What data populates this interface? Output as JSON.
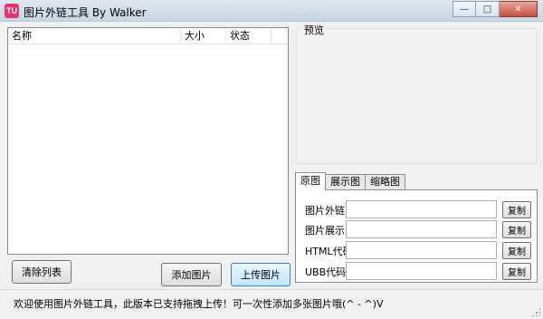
{
  "window": {
    "title": "图片外链工具 By Walker",
    "app_icon_text": "TU",
    "background_title_text": "...  ...  ...",
    "controls": {
      "minimize": "—",
      "maximize": "□",
      "close": "✕"
    }
  },
  "file_list": {
    "columns": [
      "名称",
      "大小",
      "状态",
      ""
    ],
    "rows": []
  },
  "buttons": {
    "clear": "清除列表",
    "add": "添加图片",
    "upload": "上传图片"
  },
  "preview": {
    "label": "预览"
  },
  "tabs": [
    "原图",
    "展示图",
    "缩略图"
  ],
  "link_rows": [
    {
      "label": "图片外链",
      "value": "",
      "button": "复制"
    },
    {
      "label": "图片展示",
      "value": "",
      "button": "复制"
    },
    {
      "label": "HTML代码",
      "value": "",
      "button": "复制"
    },
    {
      "label": "UBB代码",
      "value": "",
      "button": "复制"
    }
  ],
  "status": {
    "text": "欢迎使用图片外链工具，此版本已支持拖拽上传！可一次性添加多张图片哦(^ - ^)V"
  },
  "colors": {
    "accent": "#e6336b",
    "titlebar": "#cfdbe8",
    "close": "#c7503d"
  }
}
